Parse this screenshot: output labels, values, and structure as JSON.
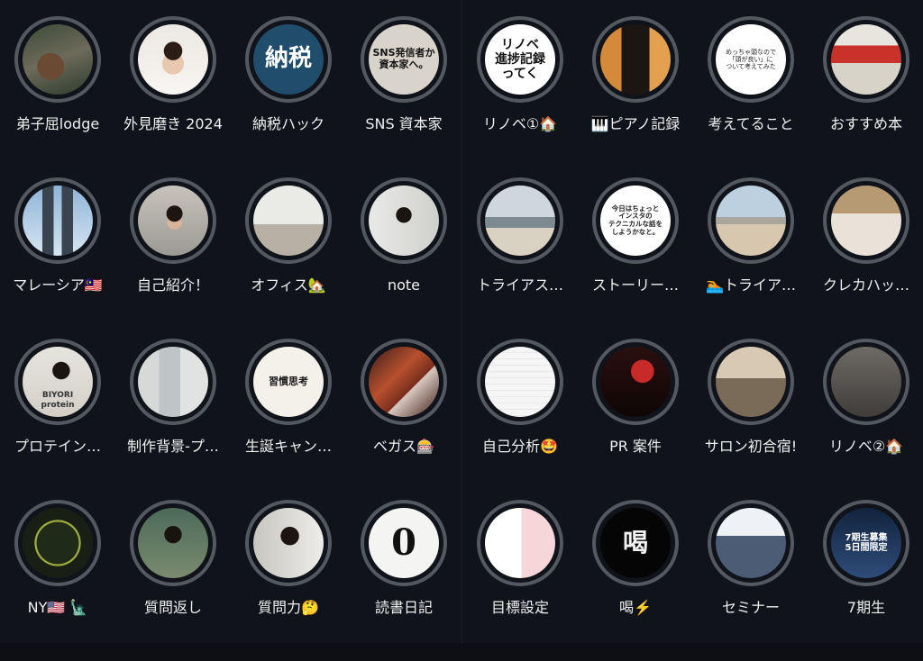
{
  "highlights": [
    {
      "label": "弟子屈lodge",
      "thumb": "forest-cabin"
    },
    {
      "label": "外見磨き 2024",
      "thumb": "portrait-white"
    },
    {
      "label": "納税ハック",
      "thumb": "tax-text",
      "text": "納税"
    },
    {
      "label": "SNS 資本家",
      "thumb": "sns-text",
      "text": "SNS発信者か\n資本家へ。"
    },
    {
      "label": "マレーシア🇲🇾",
      "thumb": "twin-towers"
    },
    {
      "label": "自己紹介！",
      "thumb": "man-smartphone"
    },
    {
      "label": "オフィス🏡",
      "thumb": "office-room"
    },
    {
      "label": "note",
      "thumb": "man-laptop"
    },
    {
      "label": "プロテイン…",
      "thumb": "protein-man",
      "text": "BIYORI\nprotein"
    },
    {
      "label": "制作背景-プ…",
      "thumb": "desk-papers"
    },
    {
      "label": "生誕キャン…",
      "thumb": "book-cover",
      "text": "習慣思考"
    },
    {
      "label": "ベガス🎰",
      "thumb": "canyon"
    },
    {
      "label": "NY🇺🇸 🗽",
      "thumb": "clock-dark"
    },
    {
      "label": "質問返し",
      "thumb": "man-outdoor"
    },
    {
      "label": "質問力🤔",
      "thumb": "man-thinking"
    },
    {
      "label": "読書日記",
      "thumb": "book-zero",
      "text": "0"
    },
    {
      "label": "リノベ①🏠",
      "thumb": "renov-text",
      "text": "リノベ\n進捗記録\nってく"
    },
    {
      "label": "🎹ピアノ記録",
      "thumb": "piano"
    },
    {
      "label": "考えてること",
      "thumb": "thinking-text",
      "text": "めっちゃ頭なので\n「頭が良い」に\nついて考えてみた"
    },
    {
      "label": "おすすめ本",
      "thumb": "books-shelf"
    },
    {
      "label": "トライアス…",
      "thumb": "cyclist"
    },
    {
      "label": "ストーリー…",
      "thumb": "story-text",
      "text": "今日はちょっと\nインスタの\nテクニカルな話を\nしようかなと。"
    },
    {
      "label": "🏊トライア…",
      "thumb": "beach-man"
    },
    {
      "label": "クレカハッ…",
      "thumb": "hotel-room"
    },
    {
      "label": "自己分析🤩",
      "thumb": "analysis-chart"
    },
    {
      "label": "PR 案件",
      "thumb": "red-hall"
    },
    {
      "label": "サロン初合宿!",
      "thumb": "group-room"
    },
    {
      "label": "リノベ②🏠",
      "thumb": "empty-room"
    },
    {
      "label": "目標設定",
      "thumb": "goal-sheet"
    },
    {
      "label": "喝⚡️",
      "thumb": "katsu-text",
      "text": "喝"
    },
    {
      "label": "セミナー",
      "thumb": "seminar"
    },
    {
      "label": "7期生",
      "thumb": "seventh-banner",
      "text": "7期生募集\n5日間限定"
    }
  ]
}
